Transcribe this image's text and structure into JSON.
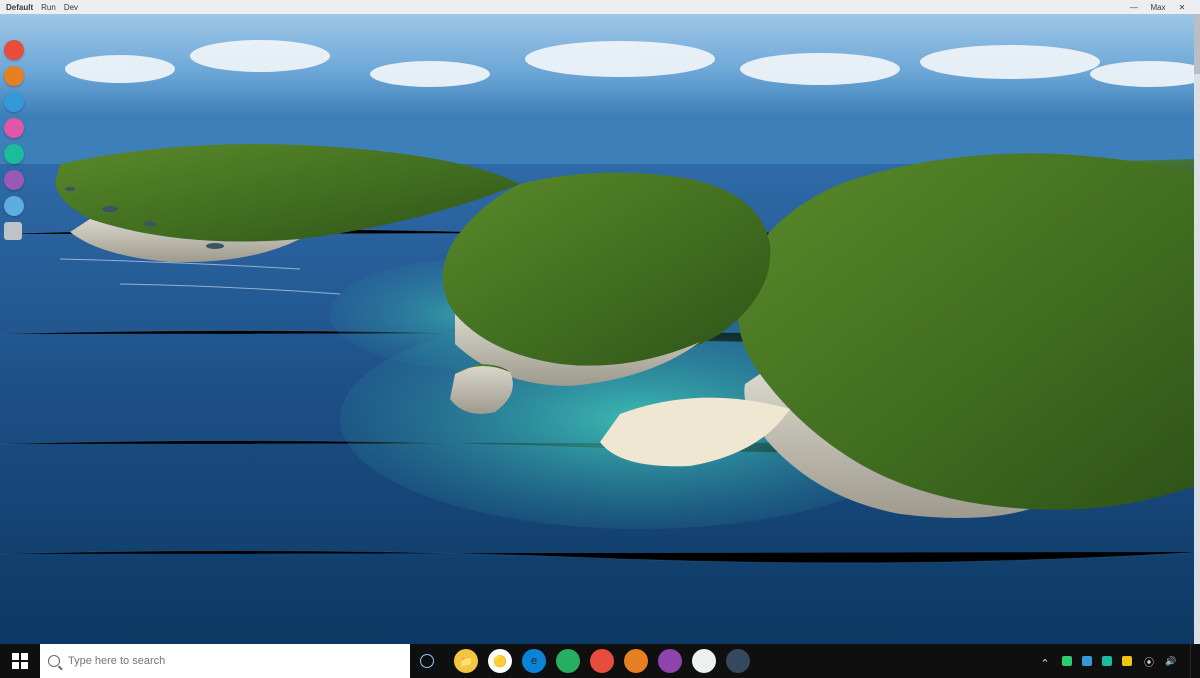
{
  "titlebar": {
    "left_items": [
      "Default",
      "Run",
      "Dev"
    ],
    "window_btn_min": "—",
    "window_btn_max": "Max",
    "window_btn_close": "✕"
  },
  "launcher": {
    "items": [
      {
        "name": "app-red",
        "color": "#e74c3c"
      },
      {
        "name": "app-orange",
        "color": "#e67e22"
      },
      {
        "name": "app-blue",
        "color": "#3498db"
      },
      {
        "name": "app-pink",
        "color": "#e056a9"
      },
      {
        "name": "app-teal",
        "color": "#1abc9c"
      },
      {
        "name": "app-purple",
        "color": "#9b59b6"
      },
      {
        "name": "app-sky",
        "color": "#5dade2"
      },
      {
        "name": "app-gray",
        "color": "#bdc3c7"
      }
    ]
  },
  "taskbar": {
    "search_placeholder": "Type here to search",
    "pinned": [
      {
        "name": "file-explorer",
        "bg": "#f4c542",
        "glyph": "📁"
      },
      {
        "name": "browser-chrome",
        "bg": "#ffffff",
        "glyph": "🟡"
      },
      {
        "name": "browser-edge",
        "bg": "#0a84d6",
        "glyph": "e"
      },
      {
        "name": "app-green",
        "bg": "#27ae60",
        "glyph": ""
      },
      {
        "name": "app-red-round",
        "bg": "#e74c3c",
        "glyph": ""
      },
      {
        "name": "app-orange-round",
        "bg": "#e67e22",
        "glyph": ""
      },
      {
        "name": "app-purple-round",
        "bg": "#8e44ad",
        "glyph": ""
      },
      {
        "name": "app-white-round",
        "bg": "#ecf0f1",
        "glyph": ""
      },
      {
        "name": "app-dark-round",
        "bg": "#34495e",
        "glyph": ""
      }
    ],
    "tray_squares": [
      {
        "name": "tray-green",
        "color": "#2ecc71"
      },
      {
        "name": "tray-blue",
        "color": "#3498db"
      },
      {
        "name": "tray-teal",
        "color": "#1abc9c"
      },
      {
        "name": "tray-amber",
        "color": "#f1c40f"
      }
    ]
  }
}
